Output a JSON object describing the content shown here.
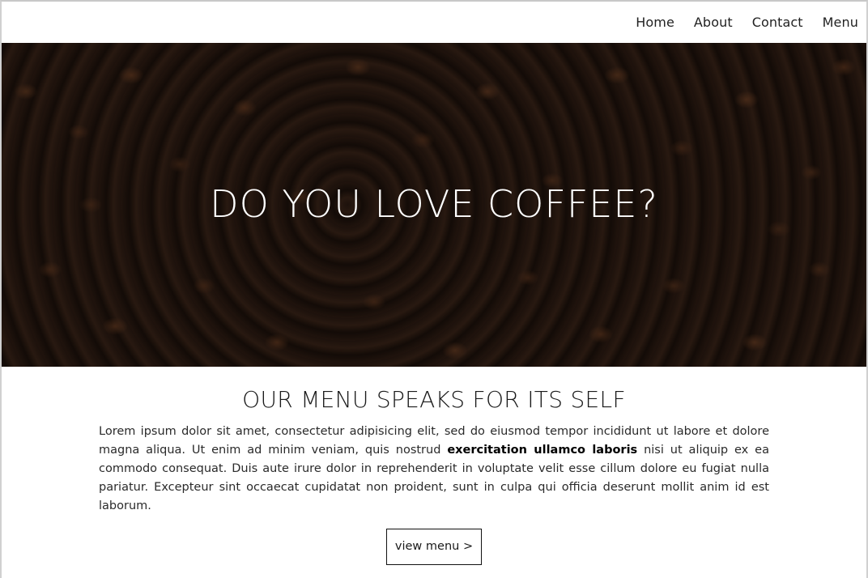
{
  "nav": {
    "items": [
      {
        "label": "Home"
      },
      {
        "label": "About"
      },
      {
        "label": "Contact"
      },
      {
        "label": "Menu"
      }
    ]
  },
  "hero": {
    "title": "DO YOU LOVE COFFEE?"
  },
  "section": {
    "title": "OUR MENU SPEAKS FOR ITS SELF",
    "paragraph_part1": "Lorem ipsum dolor sit amet, consectetur adipisicing elit, sed do eiusmod tempor incididunt ut labore et dolore magna aliqua. Ut enim ad minim veniam, quis nostrud ",
    "paragraph_emphasis": "exercitation ullamco laboris",
    "paragraph_part2": " nisi ut aliquip ex ea commodo consequat. Duis aute irure dolor in reprehenderit in voluptate velit esse cillum dolore eu fugiat nulla pariatur. Excepteur sint occaecat cupidatat non proident, sunt in culpa qui officia deserunt mollit anim id est laborum.",
    "button_label": "view menu >"
  }
}
